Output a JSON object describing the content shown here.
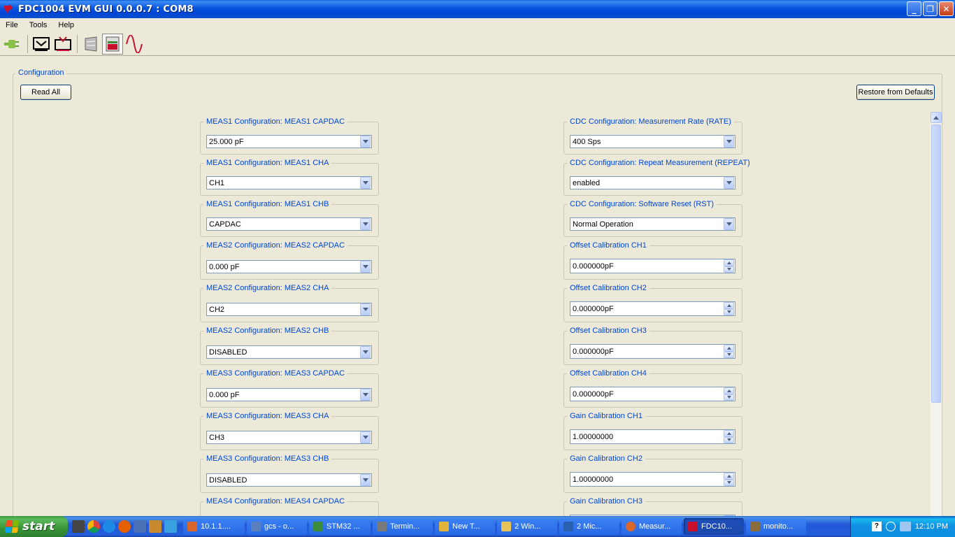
{
  "window": {
    "title": "FDC1004 EVM GUI 0.0.0.7 : COM8",
    "controls": [
      "_",
      "❐",
      "✕"
    ]
  },
  "menu": [
    "File",
    "Tools",
    "Help"
  ],
  "toolbar": {
    "icons": [
      "connect-icon",
      "download-icon",
      "upload-icon",
      "register-map-icon",
      "configuration-icon",
      "graph-icon"
    ]
  },
  "config": {
    "group_title": "Configuration",
    "read_all": "Read All",
    "restore": "Restore from Defaults"
  },
  "left_fields": [
    {
      "label": "MEAS1 Configuration: MEAS1 CAPDAC",
      "value": "25.000 pF"
    },
    {
      "label": "MEAS1 Configuration: MEAS1 CHA",
      "value": "CH1"
    },
    {
      "label": "MEAS1 Configuration: MEAS1 CHB",
      "value": "CAPDAC"
    },
    {
      "label": "MEAS2 Configuration: MEAS2 CAPDAC",
      "value": "0.000 pF"
    },
    {
      "label": "MEAS2 Configuration: MEAS2 CHA",
      "value": "CH2"
    },
    {
      "label": "MEAS2 Configuration: MEAS2 CHB",
      "value": "DISABLED"
    },
    {
      "label": "MEAS3 Configuration: MEAS3 CAPDAC",
      "value": "0.000 pF"
    },
    {
      "label": "MEAS3 Configuration: MEAS3 CHA",
      "value": "CH3"
    },
    {
      "label": "MEAS3 Configuration: MEAS3 CHB",
      "value": "DISABLED"
    },
    {
      "label": "MEAS4 Configuration: MEAS4 CAPDAC",
      "value": ""
    }
  ],
  "right_fields": [
    {
      "label": "CDC Configuration: Measurement Rate (RATE)",
      "value": "400 Sps"
    },
    {
      "label": "CDC Configuration: Repeat Measurement (REPEAT)",
      "value": "enabled"
    },
    {
      "label": "CDC Configuration: Software Reset (RST)",
      "value": "Normal Operation"
    },
    {
      "label": "Offset Calibration CH1",
      "value": "0.000000pF"
    },
    {
      "label": "Offset Calibration CH2",
      "value": "0.000000pF"
    },
    {
      "label": "Offset Calibration CH3",
      "value": "0.000000pF"
    },
    {
      "label": "Offset Calibration CH4",
      "value": "0.000000pF"
    },
    {
      "label": "Gain Calibration CH1",
      "value": "1.00000000"
    },
    {
      "label": "Gain Calibration CH2",
      "value": "1.00000000"
    },
    {
      "label": "Gain Calibration CH3",
      "value": ""
    }
  ],
  "taskbar": {
    "start": "start",
    "tasks": [
      {
        "label": "10.1.1....",
        "color": "#d9662b"
      },
      {
        "label": "gcs - o...",
        "color": "#5a7fbf"
      },
      {
        "label": "STM32 ...",
        "color": "#3a8c3a"
      },
      {
        "label": "Termin...",
        "color": "#7a7a7a"
      },
      {
        "label": "New T...",
        "color": "#e0b43a"
      },
      {
        "label": "2 Win...",
        "color": "#e8c35a"
      },
      {
        "label": "2 Mic...",
        "color": "#2b5fb0"
      },
      {
        "label": "Measur...",
        "color": "#d9662b"
      },
      {
        "label": "FDC10...",
        "color": "#c8102e"
      },
      {
        "label": "monito...",
        "color": "#8a6d3b"
      }
    ],
    "clock": "12:10 PM"
  }
}
